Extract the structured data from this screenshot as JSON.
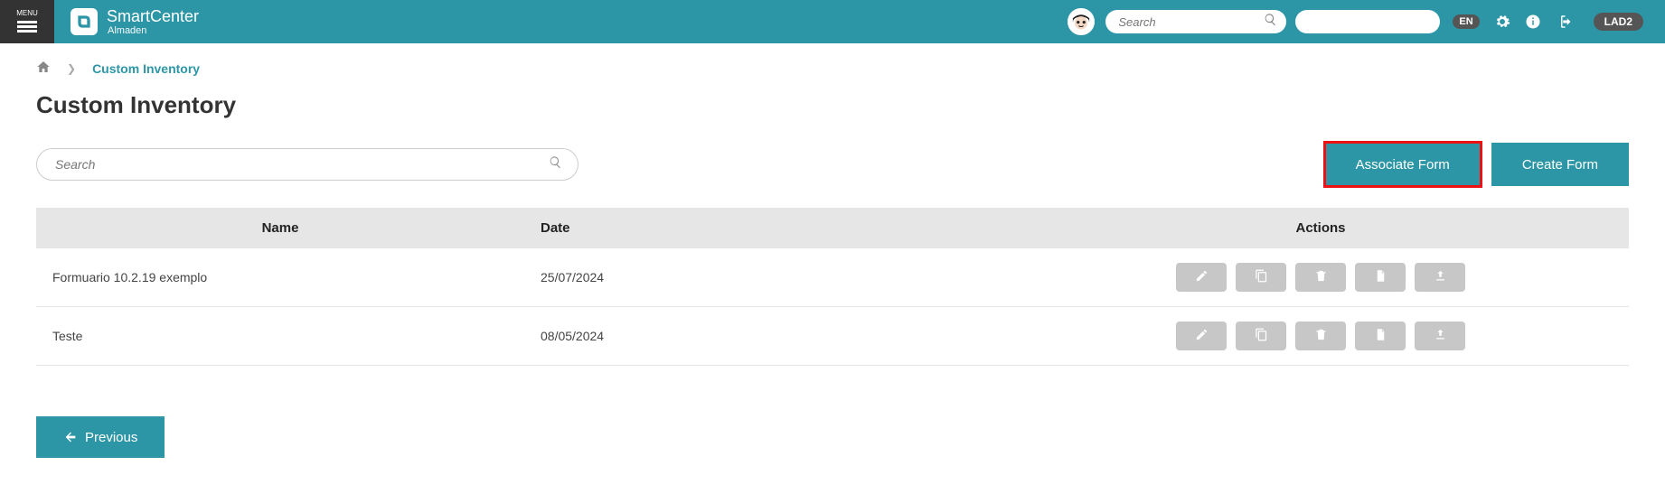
{
  "header": {
    "menu_label": "MENU",
    "brand_title": "SmartCenter",
    "brand_sub": "Almaden",
    "search_placeholder": "Search",
    "blank_value": "",
    "lang": "EN",
    "env": "LAD2"
  },
  "breadcrumb": {
    "current": "Custom Inventory"
  },
  "page": {
    "title": "Custom Inventory",
    "table_search_placeholder": "Search",
    "associate_btn": "Associate Form",
    "create_btn": "Create Form",
    "previous_btn": "Previous"
  },
  "table": {
    "columns": {
      "name": "Name",
      "date": "Date",
      "actions": "Actions"
    },
    "rows": [
      {
        "name": "Formuario 10.2.19 exemplo",
        "date": "25/07/2024"
      },
      {
        "name": "Teste",
        "date": "08/05/2024"
      }
    ]
  },
  "action_icons": [
    "edit-icon",
    "copy-icon",
    "trash-icon",
    "doc-icon",
    "upload-icon"
  ],
  "colors": {
    "primary": "#2d96a6",
    "highlight_border": "#e11"
  }
}
